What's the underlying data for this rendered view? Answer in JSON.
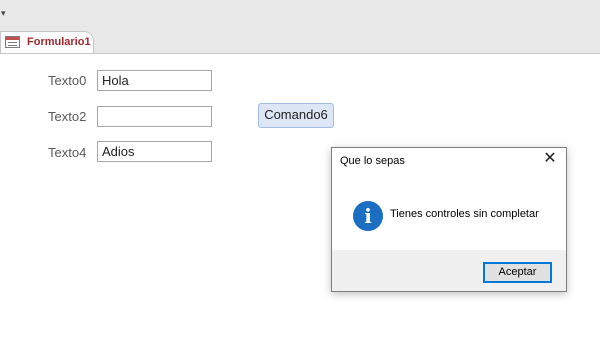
{
  "window": {
    "qat_icon": "dropdown-arrow-icon"
  },
  "tab": {
    "label": "Formulario1",
    "icon": "form-icon"
  },
  "form": {
    "fields": [
      {
        "label": "Texto0",
        "value": "Hola"
      },
      {
        "label": "Texto2",
        "value": ""
      },
      {
        "label": "Texto4",
        "value": "Adios"
      }
    ],
    "command_button": "Comando6"
  },
  "msgbox": {
    "title": "Que lo sepas",
    "close_icon": "close-icon",
    "icon": "info-icon",
    "icon_glyph": "i",
    "close_glyph": "✕",
    "message": "Tienes controles sin completar",
    "ok_label": "Aceptar"
  },
  "colors": {
    "tab_label": "#a4262c",
    "info_icon": "#1b6ec2",
    "button_focus": "#0078d7"
  }
}
